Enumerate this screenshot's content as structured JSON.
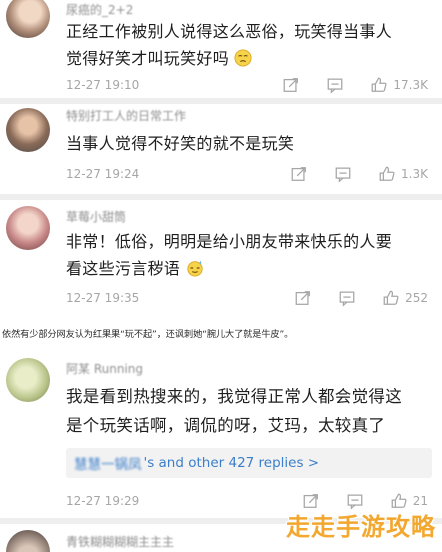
{
  "comments": [
    {
      "username": "尿癌的_2+2",
      "text_line1": "正经工作被别人说得这么恶俗，玩笑得当事人",
      "text_line2": "觉得好笑才叫玩笑好吗",
      "emoji": "sad-face-emoji",
      "time": "12-27 19:10",
      "likes": "17.3K"
    },
    {
      "username": "特别打工人的日常工作",
      "text_line1": "当事人觉得不好笑的就不是玩笑",
      "time": "12-27 19:24",
      "likes": "1.3K"
    },
    {
      "username": "草莓小甜筒",
      "text_line1": "非常！低俗，明明是给小朋友带来快乐的人要",
      "text_line2": "看这些污言秽语",
      "emoji": "sweat-face-emoji",
      "time": "12-27 19:35",
      "likes": "252"
    },
    {
      "username": "阿某 Running",
      "text_line1": "我是看到热搜来的，我觉得正常人都会觉得这",
      "text_line2": "是个玩笑话啊，调侃的呀，艾玛，太较真了",
      "reply_name": "慧慧一锅凤",
      "reply_text": "'s and other 427 replies >",
      "time": "12-27 19:29",
      "likes": "21"
    },
    {
      "username": "青铁糊糊糊糊主主主"
    }
  ],
  "caption": "依然有少部分网友认为红果果“玩不起”，还讽刺她“腕儿大了就是牛皮”。",
  "watermark": "走走手游攻略",
  "colors": {
    "link": "#3b7ec9",
    "meta": "#a6a6a6",
    "watermark": "#f2a11f"
  }
}
